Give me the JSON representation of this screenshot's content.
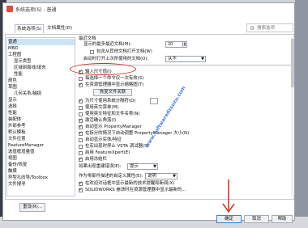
{
  "window": {
    "title": "系统选项(S) - 普通"
  },
  "tabs": [
    {
      "label": "系统选项(S)",
      "active": true
    },
    {
      "label": "文档属性(D)",
      "active": false
    }
  ],
  "search": {
    "placeholder": "搜索选项"
  },
  "tree": {
    "items": [
      {
        "label": "普通",
        "indent": 0,
        "selected": true
      },
      {
        "label": "MBD",
        "indent": 0
      },
      {
        "label": "工程图",
        "indent": 0
      },
      {
        "label": "显示类型",
        "indent": 1
      },
      {
        "label": "区域剖面线/填充",
        "indent": 1
      },
      {
        "label": "性能",
        "indent": 1
      },
      {
        "label": "颜色",
        "indent": 0
      },
      {
        "label": "草图",
        "indent": 0
      },
      {
        "label": "几何关系/捕捉",
        "indent": 1
      },
      {
        "label": "显示",
        "indent": 0
      },
      {
        "label": "选择",
        "indent": 0
      },
      {
        "label": "性能",
        "indent": 0
      },
      {
        "label": "装配体",
        "indent": 0
      },
      {
        "label": "外部参考",
        "indent": 0
      },
      {
        "label": "默认模板",
        "indent": 0
      },
      {
        "label": "文件位置",
        "indent": 0
      },
      {
        "label": "FeatureManager",
        "indent": 0
      },
      {
        "label": "选值框增量值",
        "indent": 0
      },
      {
        "label": "视图",
        "indent": 0
      },
      {
        "label": "备份/恢复",
        "indent": 0
      },
      {
        "label": "触摸",
        "indent": 0
      },
      {
        "label": "异型孔向导/Toolbox",
        "indent": 0
      },
      {
        "label": "文件搜寻",
        "indent": 0
      }
    ]
  },
  "reset_button": {
    "label": "重设(R)..."
  },
  "settings": {
    "recent_docs_header": "最近文档",
    "max_recent_label": "显示的最多最近文档(M):",
    "max_recent_value": "20",
    "include_recent_label": "包含从其他文档打开文档(W)",
    "open_last_used_label": "启动时打开上次所使用的文档(O):",
    "open_last_used_value": "从不",
    "input_dimension_label": "输入尺寸值(I)",
    "one_command_label": "每选择一个命令仅一次有效(S)",
    "show_thumbnail_label": "在资源管理器中显示缩略图(T)",
    "thumbnail_button": "恢复文件关联",
    "system_separator_label": "为尺寸使用系统分隔符(D)",
    "english_menu_label": "使用英文菜单(M)",
    "english_feature_label": "使用英文特征和文件名称(N)",
    "welcome_dialog_label": "激活确认角落(I)",
    "auto_show_pm_label": "自动显示 PropertyManager",
    "split_pm_label": "在拆分的情况下自动调整 PropertyManager 大小(N)",
    "auto_show_feature_label": "自动显示实体/特征",
    "vba_label": "在宏出现时停止 VSTA 调试器(S)",
    "featurexpert_label": "启用 FeatureXpert(E)",
    "freeze_bar_label": "启用冻结栏",
    "when_rebuild_label": "如果出现重建错误(E):",
    "when_rebuild_value": "提示",
    "custom_property_label": "作为零部件描述的自定义属性(E):",
    "custom_property_value": "说明",
    "show_latest_label": "在欢迎对话框中显示最新的技术提醒和新闻(X)",
    "solidworks_crash_label": "SOLIDWORKS 崩溃时在资源管理器中显示最新的..."
  },
  "footer": {
    "ok": "确定",
    "cancel": "取消",
    "help": "帮助"
  },
  "watermark": {
    "text": "www.softwaredzsuzu.com"
  },
  "colors": {
    "annotation": "#d9261c",
    "selection": "#cde4f7",
    "watermark": "#2b62e0"
  }
}
